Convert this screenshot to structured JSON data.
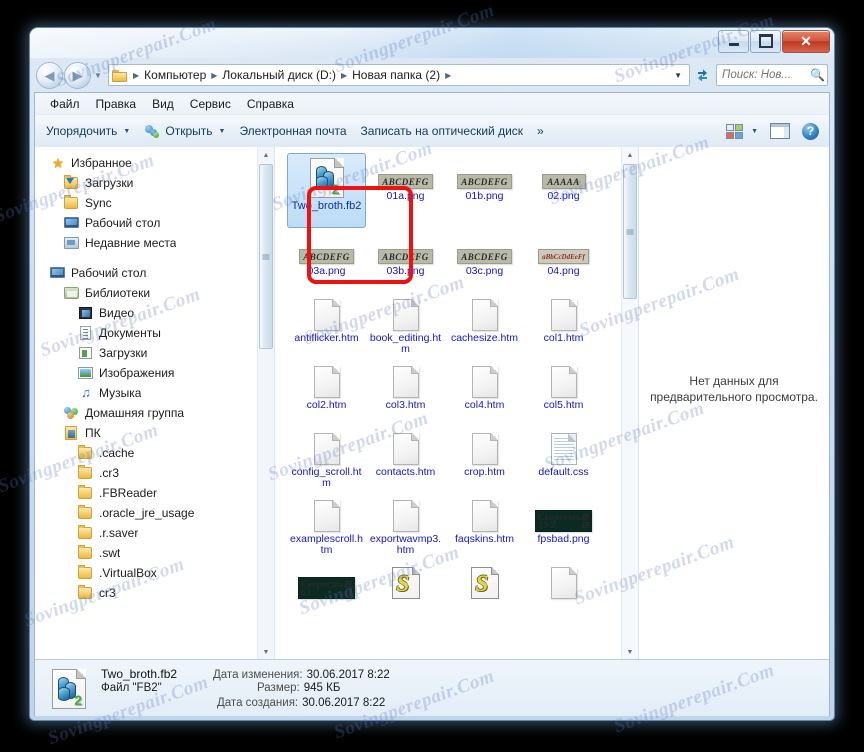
{
  "window": {
    "controls": {
      "minimize": "–",
      "maximize": "□",
      "close": "✕"
    }
  },
  "address": {
    "back_glyph": "◀",
    "forward_glyph": "▶",
    "recent_glyph": "▼",
    "crumbs": [
      "Компьютер",
      "Локальный диск (D:)",
      "Новая папка (2)"
    ],
    "separator": "▶",
    "dropdown_glyph": "▼",
    "refresh_label": "Обновить"
  },
  "search": {
    "value": "",
    "placeholder": "Поиск: Нов...",
    "icon_glyph": "🔍"
  },
  "menu": {
    "items": [
      "Файл",
      "Правка",
      "Вид",
      "Сервис",
      "Справка"
    ]
  },
  "toolbar": {
    "organize": "Упорядочить",
    "open": "Открыть",
    "email": "Электронная почта",
    "burn": "Записать на оптический диск",
    "overflow": "»",
    "caret": "▼",
    "help_glyph": "?"
  },
  "sidebar": {
    "groups": [
      {
        "header": {
          "label": "Избранное",
          "icon": "star-icon",
          "indent": 0
        },
        "items": [
          {
            "label": "Загрузки",
            "icon": "downloads-folder-icon",
            "indent": 1
          },
          {
            "label": "Sync",
            "icon": "folder-icon",
            "indent": 1
          },
          {
            "label": "Рабочий стол",
            "icon": "desktop-icon",
            "indent": 1
          },
          {
            "label": "Недавние места",
            "icon": "recent-places-icon",
            "indent": 1
          }
        ]
      },
      {
        "header": {
          "label": "Рабочий стол",
          "icon": "desktop-icon",
          "indent": 0
        },
        "items": [
          {
            "label": "Библиотеки",
            "icon": "libraries-icon",
            "indent": 1
          },
          {
            "label": "Видео",
            "icon": "video-library-icon",
            "indent": 2
          },
          {
            "label": "Документы",
            "icon": "documents-library-icon",
            "indent": 2
          },
          {
            "label": "Загрузки",
            "icon": "downloads-library-icon",
            "indent": 2
          },
          {
            "label": "Изображения",
            "icon": "pictures-library-icon",
            "indent": 2
          },
          {
            "label": "Музыка",
            "icon": "music-library-icon",
            "indent": 2
          },
          {
            "label": "Домашняя группа",
            "icon": "homegroup-icon",
            "indent": 1
          },
          {
            "label": "ПК",
            "icon": "user-folder-icon",
            "indent": 1
          },
          {
            "label": ".cache",
            "icon": "folder-icon",
            "indent": 2
          },
          {
            "label": ".cr3",
            "icon": "folder-icon",
            "indent": 2
          },
          {
            "label": ".FBReader",
            "icon": "folder-icon",
            "indent": 2
          },
          {
            "label": ".oracle_jre_usage",
            "icon": "folder-icon",
            "indent": 2
          },
          {
            "label": ".r.saver",
            "icon": "folder-icon",
            "indent": 2
          },
          {
            "label": ".swt",
            "icon": "folder-icon",
            "indent": 2
          },
          {
            "label": ".VirtualBox",
            "icon": "folder-icon",
            "indent": 2
          },
          {
            "label": "cr3",
            "icon": "folder-icon",
            "indent": 2
          }
        ]
      }
    ],
    "scroll_up_glyph": "▲",
    "scroll_down_glyph": "▼"
  },
  "files": {
    "items": [
      {
        "name": "Two_broth.fb2",
        "icon": "fb2-file-icon",
        "selected": true
      },
      {
        "name": "01a.png",
        "icon": "png-thumb",
        "thumb": "ABCDEFG",
        "thumb_style": "italic"
      },
      {
        "name": "01b.png",
        "icon": "png-thumb",
        "thumb": "ABCDEFG",
        "thumb_style": "italic"
      },
      {
        "name": "02.png",
        "icon": "png-thumb",
        "thumb": "AAAAA",
        "thumb_style": "italic"
      },
      {
        "name": "03a.png",
        "icon": "png-thumb",
        "thumb": "ABCDEFG",
        "thumb_style": "italic"
      },
      {
        "name": "03b.png",
        "icon": "png-thumb",
        "thumb": "ABCDEFG",
        "thumb_style": "italic"
      },
      {
        "name": "03c.png",
        "icon": "png-thumb",
        "thumb": "ABCDEFG",
        "thumb_style": "italic"
      },
      {
        "name": "04.png",
        "icon": "png-thumb",
        "thumb": "aBbCcDdEeFf",
        "thumb_style": "mixed"
      },
      {
        "name": "antiflicker.htm",
        "icon": "blank-page-icon"
      },
      {
        "name": "book_editing.htm",
        "icon": "blank-page-icon"
      },
      {
        "name": "cachesize.htm",
        "icon": "blank-page-icon"
      },
      {
        "name": "col1.htm",
        "icon": "blank-page-icon"
      },
      {
        "name": "col2.htm",
        "icon": "blank-page-icon"
      },
      {
        "name": "col3.htm",
        "icon": "blank-page-icon"
      },
      {
        "name": "col4.htm",
        "icon": "blank-page-icon"
      },
      {
        "name": "col5.htm",
        "icon": "blank-page-icon"
      },
      {
        "name": "config_scroll.htm",
        "icon": "blank-page-icon"
      },
      {
        "name": "contacts.htm",
        "icon": "blank-page-icon"
      },
      {
        "name": "crop.htm",
        "icon": "blank-page-icon"
      },
      {
        "name": "default.css",
        "icon": "css-file-icon"
      },
      {
        "name": "examplescroll.htm",
        "icon": "blank-page-icon"
      },
      {
        "name": "exportwavmp3.htm",
        "icon": "blank-page-icon"
      },
      {
        "name": "faqskins.htm",
        "icon": "blank-page-icon"
      },
      {
        "name": "fpsbad.png",
        "icon": "png-thumb-dark",
        "thumb_label": "Скорость",
        "thumb_value": "53·2"
      }
    ],
    "partial_row": [
      {
        "icon": "png-thumb-dark",
        "thumb_label": "Скорость",
        "thumb_value": "63"
      },
      {
        "icon": "script-file-icon"
      },
      {
        "icon": "script-file-icon"
      },
      {
        "icon": "blank-page-icon"
      }
    ],
    "scroll_up_glyph": "▲",
    "scroll_down_glyph": "▼"
  },
  "preview": {
    "message": "Нет данных для предварительного просмотра."
  },
  "details": {
    "file_name": "Two_broth.fb2",
    "file_type": "Файл \"FB2\"",
    "modified_key": "Дата изменения:",
    "modified_value": "30.06.2017 8:22",
    "size_key": "Размер:",
    "size_value": "945 КБ",
    "created_key": "Дата создания:",
    "created_value": "30.06.2017 8:22"
  },
  "watermark": {
    "text": "Sovingperepair.Com"
  },
  "colors": {
    "accent": "#1414cf",
    "selection": "#bcdcf6",
    "highlight_box": "#ee1111",
    "close_button": "#bb3820"
  }
}
